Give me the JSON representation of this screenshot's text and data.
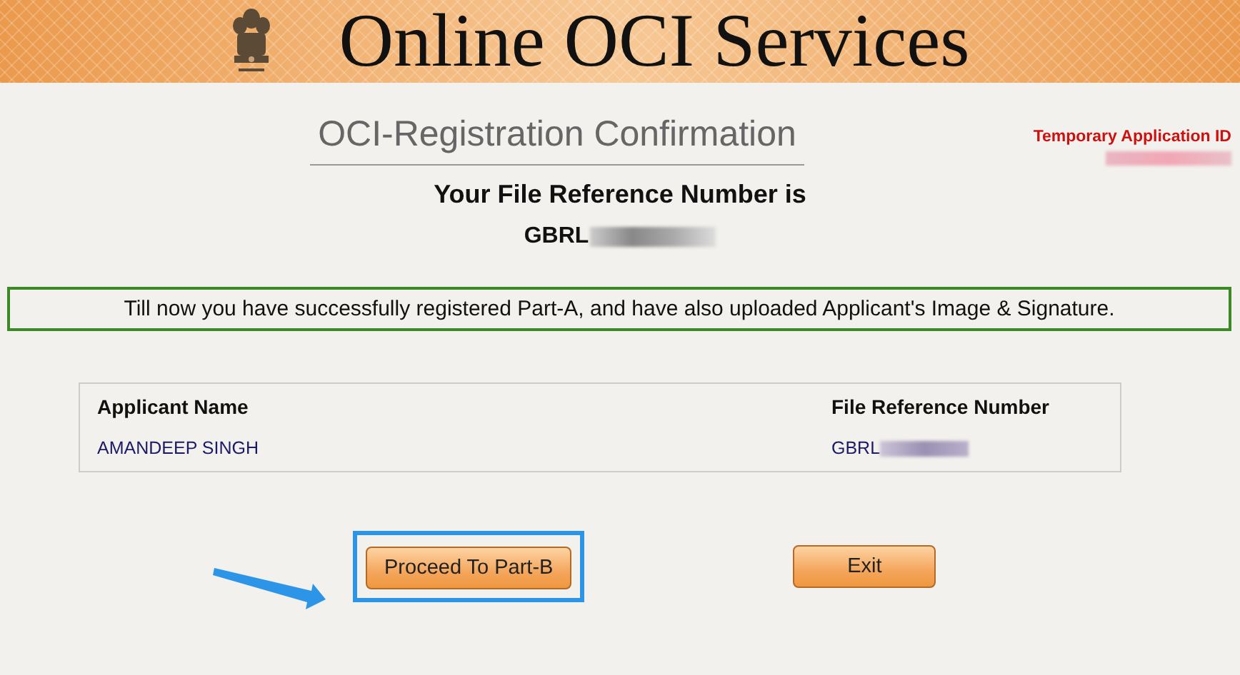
{
  "header": {
    "title": "Online OCI Services"
  },
  "page_title": "OCI-Registration Confirmation",
  "temporary_application_id": {
    "label": "Temporary Application ID"
  },
  "file_reference": {
    "heading": "Your File Reference Number is",
    "value_prefix": "GBRL"
  },
  "notice": "Till now you have successfully registered Part-A, and have also uploaded Applicant's Image & Signature.",
  "table": {
    "columns": [
      "Applicant Name",
      "File Reference Number"
    ],
    "rows": [
      [
        "AMANDEEP SINGH",
        "GBRL"
      ]
    ]
  },
  "buttons": [
    {
      "label": "Proceed To Part-B",
      "highlighted": true
    },
    {
      "label": "Exit",
      "highlighted": false
    }
  ]
}
